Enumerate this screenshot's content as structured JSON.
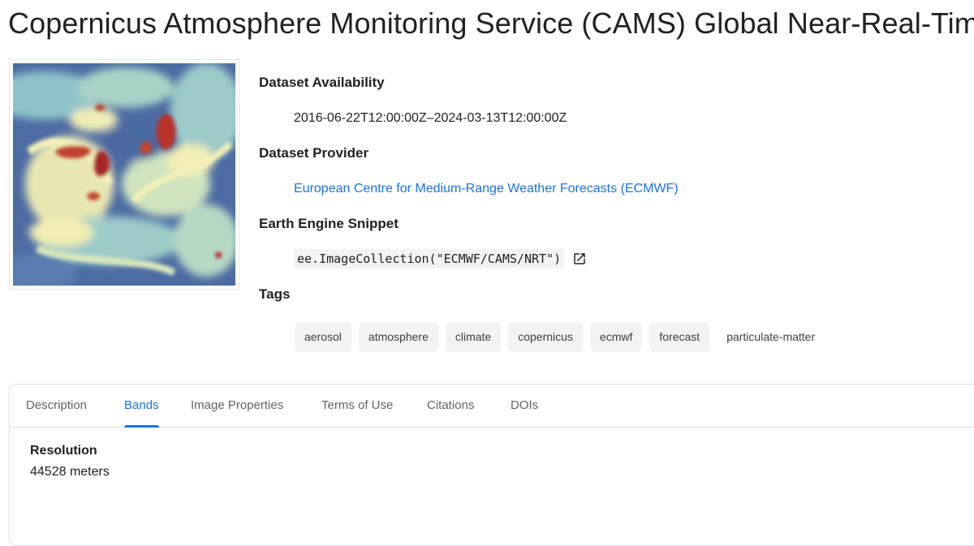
{
  "page": {
    "title": "Copernicus Atmosphere Monitoring Service (CAMS) Global Near-Real-Time"
  },
  "thumbnail": {
    "colors": {
      "background": "#4f6fa6",
      "low": "#3b5a9c",
      "mid": "#8fc3c9",
      "high": "#f2eeb4",
      "hot": "#b5242a"
    }
  },
  "metadata": {
    "availability_label": "Dataset Availability",
    "availability_value": "2016-06-22T12:00:00Z–2024-03-13T12:00:00Z",
    "provider_label": "Dataset Provider",
    "provider_value": "European Centre for Medium-Range Weather Forecasts (ECMWF)",
    "snippet_label": "Earth Engine Snippet",
    "snippet_value": "ee.ImageCollection(\"ECMWF/CAMS/NRT\")",
    "snippet_icon": "open-in-new-icon",
    "tags_label": "Tags",
    "tags": [
      "aerosol",
      "atmosphere",
      "climate",
      "copernicus",
      "ecmwf",
      "forecast",
      "particulate-matter"
    ]
  },
  "tabs": [
    "Description",
    "Bands",
    "Image Properties",
    "Terms of Use",
    "Citations",
    "DOIs"
  ],
  "active_tab": "Bands",
  "bands": {
    "resolution_label": "Resolution",
    "resolution_value": "44528 meters"
  },
  "colors": {
    "accent": "#1a73e8",
    "tag_bg": "#f1f3f4"
  }
}
